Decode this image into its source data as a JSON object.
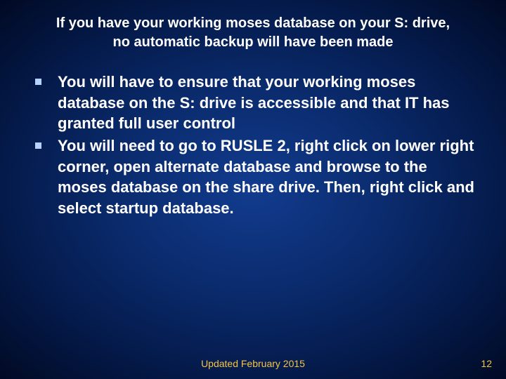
{
  "slide": {
    "title": "If you have your working moses database on your S: drive,\nno automatic backup will have been made",
    "bullets": [
      "You will have to ensure that your working moses database on the S: drive is accessible and that IT has granted full user control",
      " You will need to go to RUSLE 2, right click on lower right corner, open alternate database and browse to the moses database on the share drive.   Then, right click and select startup database."
    ],
    "footer": {
      "center": "Updated February 2015",
      "page": "12"
    }
  }
}
